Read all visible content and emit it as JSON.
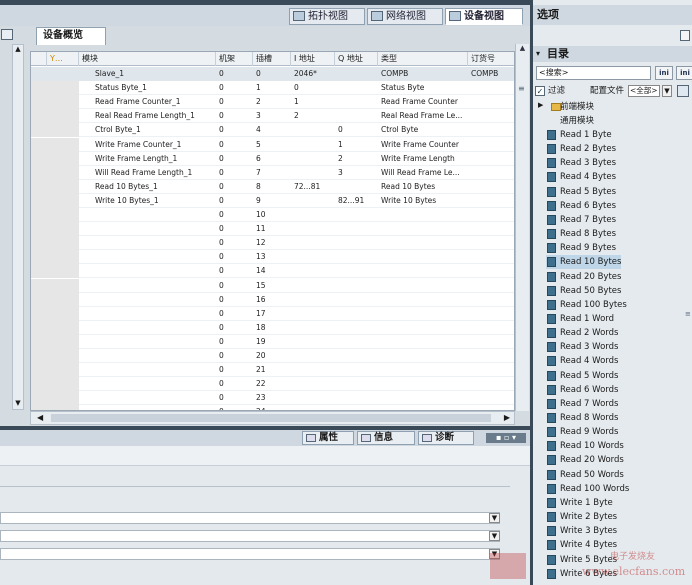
{
  "view_tabs": {
    "topology": "拓扑视图",
    "network": "网络视图",
    "device": "设备视图"
  },
  "overview_tab": "设备概览",
  "table": {
    "headers": [
      "",
      "模块",
      "机架",
      "插槽",
      "I 地址",
      "Q 地址",
      "类型",
      "订货号"
    ],
    "rows": [
      {
        "module": "Slave_1",
        "rack": "0",
        "slot": "0",
        "iaddr": "2046*",
        "qaddr": "",
        "type": "COMPB",
        "order": "COMPB"
      },
      {
        "module": "Status Byte_1",
        "rack": "0",
        "slot": "1",
        "iaddr": "0",
        "qaddr": "",
        "type": "Status Byte",
        "order": ""
      },
      {
        "module": "Read Frame Counter_1",
        "rack": "0",
        "slot": "2",
        "iaddr": "1",
        "qaddr": "",
        "type": "Read Frame Counter",
        "order": ""
      },
      {
        "module": "Real Read Frame Length_1",
        "rack": "0",
        "slot": "3",
        "iaddr": "2",
        "qaddr": "",
        "type": "Real Read Frame Le...",
        "order": ""
      },
      {
        "module": "Ctrol Byte_1",
        "rack": "0",
        "slot": "4",
        "iaddr": "",
        "qaddr": "0",
        "type": "Ctrol Byte",
        "order": ""
      },
      {
        "module": "Write Frame Counter_1",
        "rack": "0",
        "slot": "5",
        "iaddr": "",
        "qaddr": "1",
        "type": "Write Frame Counter",
        "order": ""
      },
      {
        "module": "Write Frame Length_1",
        "rack": "0",
        "slot": "6",
        "iaddr": "",
        "qaddr": "2",
        "type": "Write Frame Length",
        "order": ""
      },
      {
        "module": "Will Read Frame Length_1",
        "rack": "0",
        "slot": "7",
        "iaddr": "",
        "qaddr": "3",
        "type": "Will Read Frame Le...",
        "order": ""
      },
      {
        "module": "Read 10 Bytes_1",
        "rack": "0",
        "slot": "8",
        "iaddr": "72...81",
        "qaddr": "",
        "type": "Read 10 Bytes",
        "order": ""
      },
      {
        "module": "Write 10 Bytes_1",
        "rack": "0",
        "slot": "9",
        "iaddr": "",
        "qaddr": "82...91",
        "type": "Write 10 Bytes",
        "order": ""
      },
      {
        "module": "",
        "rack": "0",
        "slot": "10",
        "iaddr": "",
        "qaddr": "",
        "type": "",
        "order": ""
      },
      {
        "module": "",
        "rack": "0",
        "slot": "11",
        "iaddr": "",
        "qaddr": "",
        "type": "",
        "order": ""
      },
      {
        "module": "",
        "rack": "0",
        "slot": "12",
        "iaddr": "",
        "qaddr": "",
        "type": "",
        "order": ""
      },
      {
        "module": "",
        "rack": "0",
        "slot": "13",
        "iaddr": "",
        "qaddr": "",
        "type": "",
        "order": ""
      },
      {
        "module": "",
        "rack": "0",
        "slot": "14",
        "iaddr": "",
        "qaddr": "",
        "type": "",
        "order": ""
      },
      {
        "module": "",
        "rack": "0",
        "slot": "15",
        "iaddr": "",
        "qaddr": "",
        "type": "",
        "order": ""
      },
      {
        "module": "",
        "rack": "0",
        "slot": "16",
        "iaddr": "",
        "qaddr": "",
        "type": "",
        "order": ""
      },
      {
        "module": "",
        "rack": "0",
        "slot": "17",
        "iaddr": "",
        "qaddr": "",
        "type": "",
        "order": ""
      },
      {
        "module": "",
        "rack": "0",
        "slot": "18",
        "iaddr": "",
        "qaddr": "",
        "type": "",
        "order": ""
      },
      {
        "module": "",
        "rack": "0",
        "slot": "19",
        "iaddr": "",
        "qaddr": "",
        "type": "",
        "order": ""
      },
      {
        "module": "",
        "rack": "0",
        "slot": "20",
        "iaddr": "",
        "qaddr": "",
        "type": "",
        "order": ""
      },
      {
        "module": "",
        "rack": "0",
        "slot": "21",
        "iaddr": "",
        "qaddr": "",
        "type": "",
        "order": ""
      },
      {
        "module": "",
        "rack": "0",
        "slot": "22",
        "iaddr": "",
        "qaddr": "",
        "type": "",
        "order": ""
      },
      {
        "module": "",
        "rack": "0",
        "slot": "23",
        "iaddr": "",
        "qaddr": "",
        "type": "",
        "order": ""
      },
      {
        "module": "",
        "rack": "0",
        "slot": "24",
        "iaddr": "",
        "qaddr": "",
        "type": "",
        "order": ""
      }
    ]
  },
  "prop_tabs": {
    "properties": "属性",
    "info": "信息",
    "diag": "诊断"
  },
  "right_panel": {
    "title": "选项",
    "catalog_title": "目录",
    "search_placeholder": "<搜索>",
    "filter_label": "过滤",
    "profile_label": "配置文件",
    "profile_value": "<全部>",
    "folder": "前端模块",
    "universal": "通用模块",
    "items": [
      "Read 1 Byte",
      "Read 2 Bytes",
      "Read 3 Bytes",
      "Read 4 Bytes",
      "Read 5 Bytes",
      "Read 6 Bytes",
      "Read 7 Bytes",
      "Read 8 Bytes",
      "Read 9 Bytes",
      "Read 10 Bytes",
      "Read 20 Bytes",
      "Read 50 Bytes",
      "Read 100 Bytes",
      "Read 1 Word",
      "Read 2 Words",
      "Read 3 Words",
      "Read 4 Words",
      "Read 5 Words",
      "Read 6 Words",
      "Read 7 Words",
      "Read 8 Words",
      "Read 9 Words",
      "Read 10 Words",
      "Read 20 Words",
      "Read 50 Words",
      "Read 100 Words",
      "Write 1 Byte",
      "Write 2 Bytes",
      "Write 3 Bytes",
      "Write 4 Bytes",
      "Write 5 Bytes",
      "Write 6 Bytes"
    ],
    "selected_item": "Read 10 Bytes"
  },
  "watermark": "电子发烧友 www.elecfans.com"
}
